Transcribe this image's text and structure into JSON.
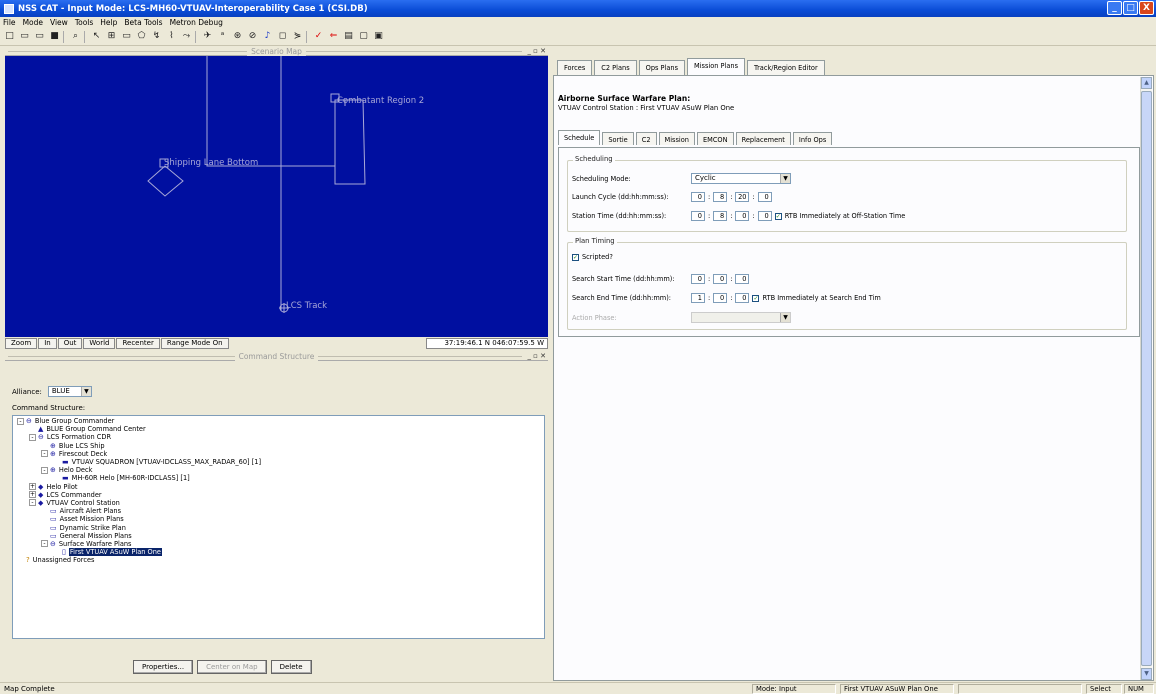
{
  "window": {
    "title": "NSS CAT - Input Mode: LCS-MH60-VTUAV-Interoperability Case 1 (CSI.DB)",
    "controls": [
      "_",
      "□",
      "X"
    ]
  },
  "menu": [
    "File",
    "Mode",
    "View",
    "Tools",
    "Help",
    "Beta Tools",
    "Metron Debug"
  ],
  "scenario_map": {
    "title": "Scenario Map",
    "labels": {
      "combatant": "Combatant Region 2",
      "shipping": "Shipping Lane Bottom",
      "lcs_track": "LCS Track"
    },
    "colors": {
      "background": "#000fa0",
      "lines": "#a8a8d8"
    },
    "zoom_buttons": [
      "Zoom",
      "In",
      "Out",
      "World",
      "Recenter",
      "Range Mode On"
    ],
    "coords": "37:19:46.1 N 046:07:59.5 W"
  },
  "command_structure": {
    "title": "Command Structure",
    "alliance_label": "Alliance:",
    "alliance_value": "BLUE",
    "structure_label": "Command Structure:",
    "tree": [
      {
        "label": "Blue Group Commander",
        "level": 0,
        "icon": "group-icon",
        "exp": "-"
      },
      {
        "label": "BLUE Group Command Center",
        "level": 1,
        "icon": "center-icon"
      },
      {
        "label": "LCS Formation CDR",
        "level": 1,
        "icon": "group-icon",
        "exp": "-"
      },
      {
        "label": "Blue LCS Ship",
        "level": 2,
        "icon": "ship-icon"
      },
      {
        "label": "Firescout Deck",
        "level": 2,
        "icon": "deck-icon",
        "exp": "-"
      },
      {
        "label": "VTUAV SQUADRON    [VTUAV-IDCLASS_MAX_RADAR_60]    [1]",
        "level": 3,
        "icon": "aircraft-icon"
      },
      {
        "label": "Helo Deck",
        "level": 2,
        "icon": "deck-icon",
        "exp": "-"
      },
      {
        "label": "MH-60R Helo    [MH-60R-IDCLASS]    [1]",
        "level": 3,
        "icon": "aircraft-icon"
      },
      {
        "label": "Helo Pilot",
        "level": 1,
        "icon": "diamond-icon",
        "exp": "+"
      },
      {
        "label": "LCS Commander",
        "level": 1,
        "icon": "diamond-icon",
        "exp": "+"
      },
      {
        "label": "VTUAV Control Station",
        "level": 1,
        "icon": "diamond-icon",
        "exp": "-"
      },
      {
        "label": "Aircraft Alert Plans",
        "level": 2,
        "icon": "folder-icon"
      },
      {
        "label": "Asset Mission Plans",
        "level": 2,
        "icon": "folder-icon"
      },
      {
        "label": "Dynamic Strike Plan",
        "level": 2,
        "icon": "folder-icon"
      },
      {
        "label": "General Mission Plans",
        "level": 2,
        "icon": "folder-icon"
      },
      {
        "label": "Surface Warfare Plans",
        "level": 2,
        "icon": "group-icon",
        "exp": "-"
      },
      {
        "label": "First VTUAV ASuW Plan One",
        "level": 3,
        "icon": "document-icon",
        "selected": true
      },
      {
        "label": "Unassigned Forces",
        "level": 0,
        "icon": "question-icon"
      }
    ],
    "buttons": {
      "properties": "Properties...",
      "center_on_map": "Center on Map",
      "delete": "Delete"
    }
  },
  "right_panel": {
    "tabs": [
      "Forces",
      "C2 Plans",
      "Ops Plans",
      "Mission Plans",
      "Track/Region Editor"
    ],
    "active_tab": 3,
    "plan_title": "Airborne Surface Warfare Plan:",
    "plan_subtitle": "VTUAV Control Station : First VTUAV ASuW Plan One",
    "subtabs": [
      "Schedule",
      "Sortie",
      "C2",
      "Mission",
      "EMCON",
      "Replacement",
      "Info Ops"
    ],
    "scheduling": {
      "group": "Scheduling",
      "mode_label": "Scheduling Mode:",
      "mode_value": "Cyclic",
      "launch_label": "Launch Cycle (dd:hh:mm:ss):",
      "launch_values": [
        "0",
        "8",
        "20",
        "0"
      ],
      "station_label": "Station Time (dd:hh:mm:ss):",
      "station_values": [
        "0",
        "8",
        "0",
        "0"
      ],
      "rtb_station": "RTB Immediately at Off-Station Time"
    },
    "plan_timing": {
      "group": "Plan Timing",
      "scripted": "Scripted?",
      "start_label": "Search Start Time (dd:hh:mm):",
      "start_values": [
        "0",
        "0",
        "0"
      ],
      "end_label": "Search End Time (dd:hh:mm):",
      "end_values": [
        "1",
        "0",
        "0"
      ],
      "rtb_end": "RTB Immediately at Search End Tim",
      "action_phase": "Action Phase:"
    }
  },
  "status": {
    "left": "Map Complete",
    "mode": "Mode: Input",
    "plan": "First VTUAV ASuW Plan One",
    "select": "Select",
    "num": "NUM"
  }
}
